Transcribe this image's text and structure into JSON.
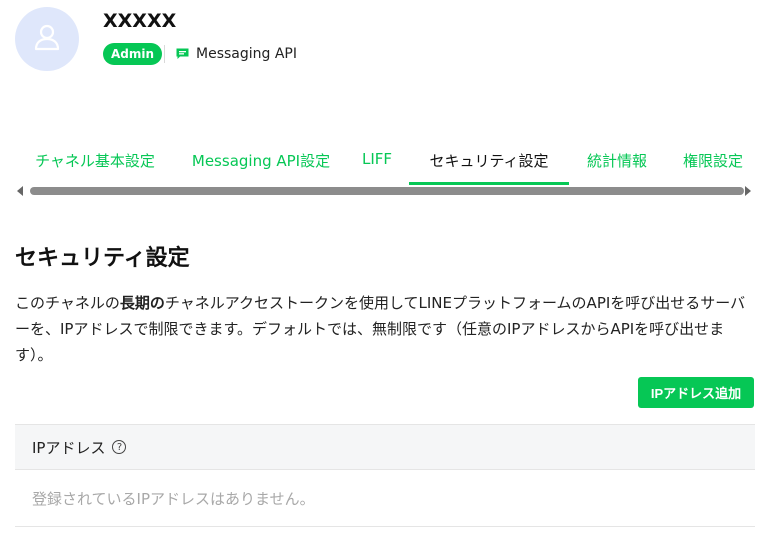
{
  "channel": {
    "name": "XXXXX",
    "role_badge": "Admin",
    "channel_type": "Messaging API",
    "channel_type_icon": "chat-bubble-icon",
    "avatar_icon": "user-icon"
  },
  "tabs": [
    {
      "label": "チャネル基本設定",
      "active": false
    },
    {
      "label": "Messaging API設定",
      "active": false
    },
    {
      "label": "LIFF",
      "active": false
    },
    {
      "label": "セキュリティ設定",
      "active": true
    },
    {
      "label": "統計情報",
      "active": false
    },
    {
      "label": "権限設定",
      "active": false
    }
  ],
  "main": {
    "title": "セキュリティ設定",
    "description_prefix": "このチャネルの",
    "description_bold": "長期の",
    "description_suffix": "チャネルアクセストークンを使用してLINEプラットフォームのAPIを呼び出せるサーバーを、IPアドレスで制限できます。デフォルトでは、無制限です（任意のIPアドレスからAPIを呼び出せます）。",
    "add_button_label": "IPアドレス追加",
    "table": {
      "column_label": "IPアドレス",
      "help_icon_glyph": "?",
      "empty_message": "登録されているIPアドレスはありません。"
    }
  },
  "colors": {
    "accent": "#06c755",
    "avatar_bg": "#dfe7fb",
    "scrollbar": "#8c8c8c"
  }
}
